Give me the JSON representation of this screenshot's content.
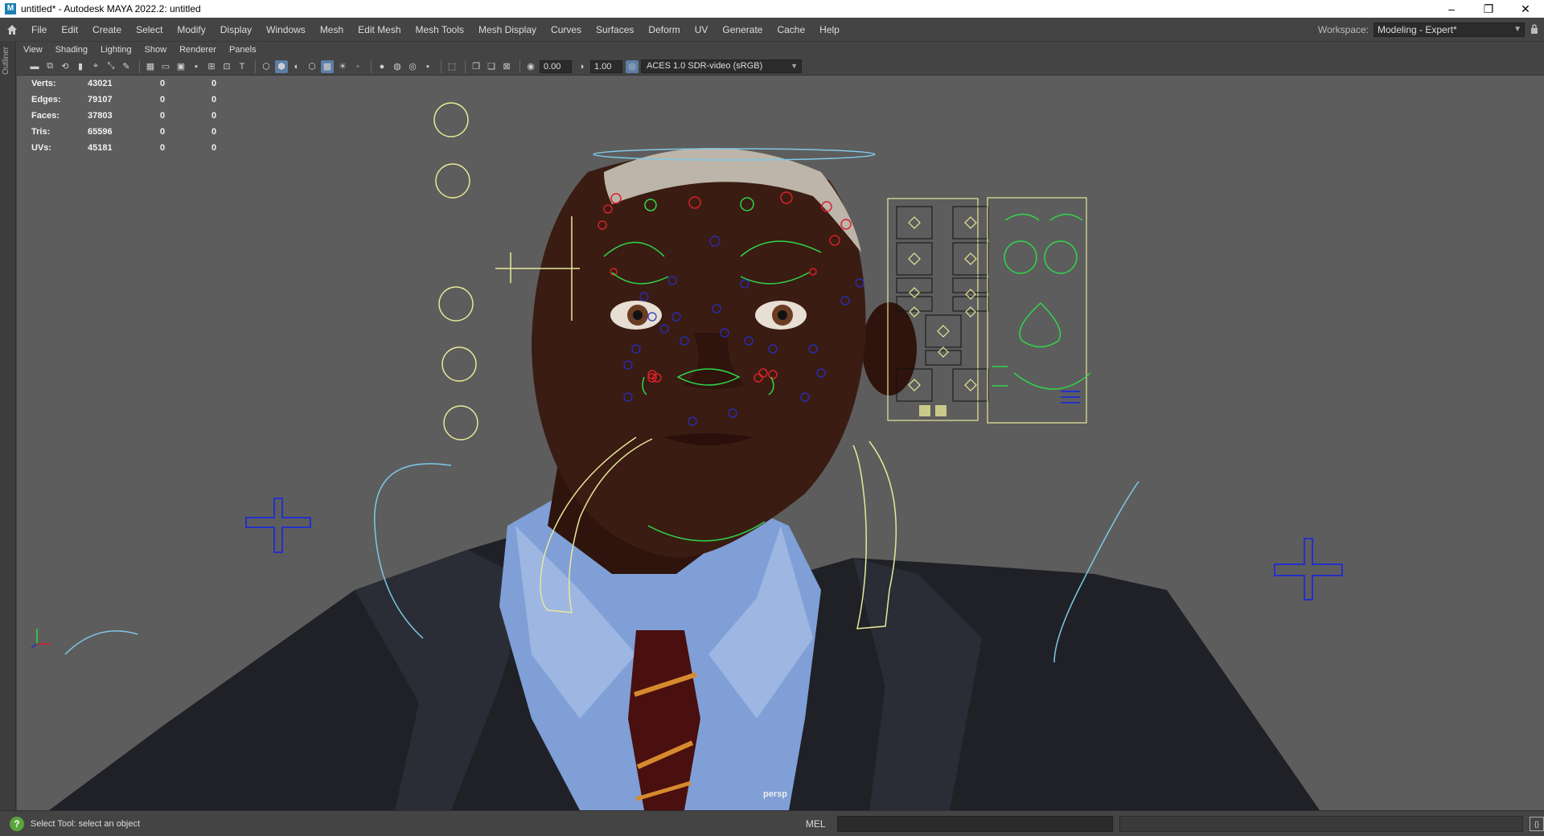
{
  "window": {
    "title": "untitled* - Autodesk MAYA 2022.2: untitled",
    "app_icon": "M",
    "minimize": "–",
    "restore": "❐",
    "close": "✕"
  },
  "menubar": {
    "items": [
      "File",
      "Edit",
      "Create",
      "Select",
      "Modify",
      "Display",
      "Windows",
      "Mesh",
      "Edit Mesh",
      "Mesh Tools",
      "Mesh Display",
      "Curves",
      "Surfaces",
      "Deform",
      "UV",
      "Generate",
      "Cache",
      "Help"
    ]
  },
  "workspace": {
    "label": "Workspace:",
    "value": "Modeling - Expert*"
  },
  "left_strip": {
    "label": "Outliner"
  },
  "panel_menu": {
    "items": [
      "View",
      "Shading",
      "Lighting",
      "Show",
      "Renderer",
      "Panels"
    ]
  },
  "view_toolbar": {
    "exposure": "0.00",
    "gamma": "1.00",
    "color_space": "ACES 1.0 SDR-video (sRGB)"
  },
  "hud": {
    "rows": [
      {
        "label": "Verts:",
        "v1": "43021",
        "v2": "0",
        "v3": "0"
      },
      {
        "label": "Edges:",
        "v1": "79107",
        "v2": "0",
        "v3": "0"
      },
      {
        "label": "Faces:",
        "v1": "37803",
        "v2": "0",
        "v3": "0"
      },
      {
        "label": "Tris:",
        "v1": "65596",
        "v2": "0",
        "v3": "0"
      },
      {
        "label": "UVs:",
        "v1": "45181",
        "v2": "0",
        "v3": "0"
      }
    ]
  },
  "viewport": {
    "camera": "persp",
    "background_color": "#5d5d5d"
  },
  "statusbar": {
    "help_text": "Select Tool: select an object",
    "mel_label": "MEL"
  },
  "colors": {
    "skin": "#3a1c12",
    "shirt": "#7f9fd6",
    "suit": "#202228",
    "rig_yellow": "#e8e89a",
    "rig_green": "#2fd74a",
    "rig_red": "#d8202a",
    "rig_blue": "#2430c8",
    "rig_cyan": "#7fc8e6"
  }
}
